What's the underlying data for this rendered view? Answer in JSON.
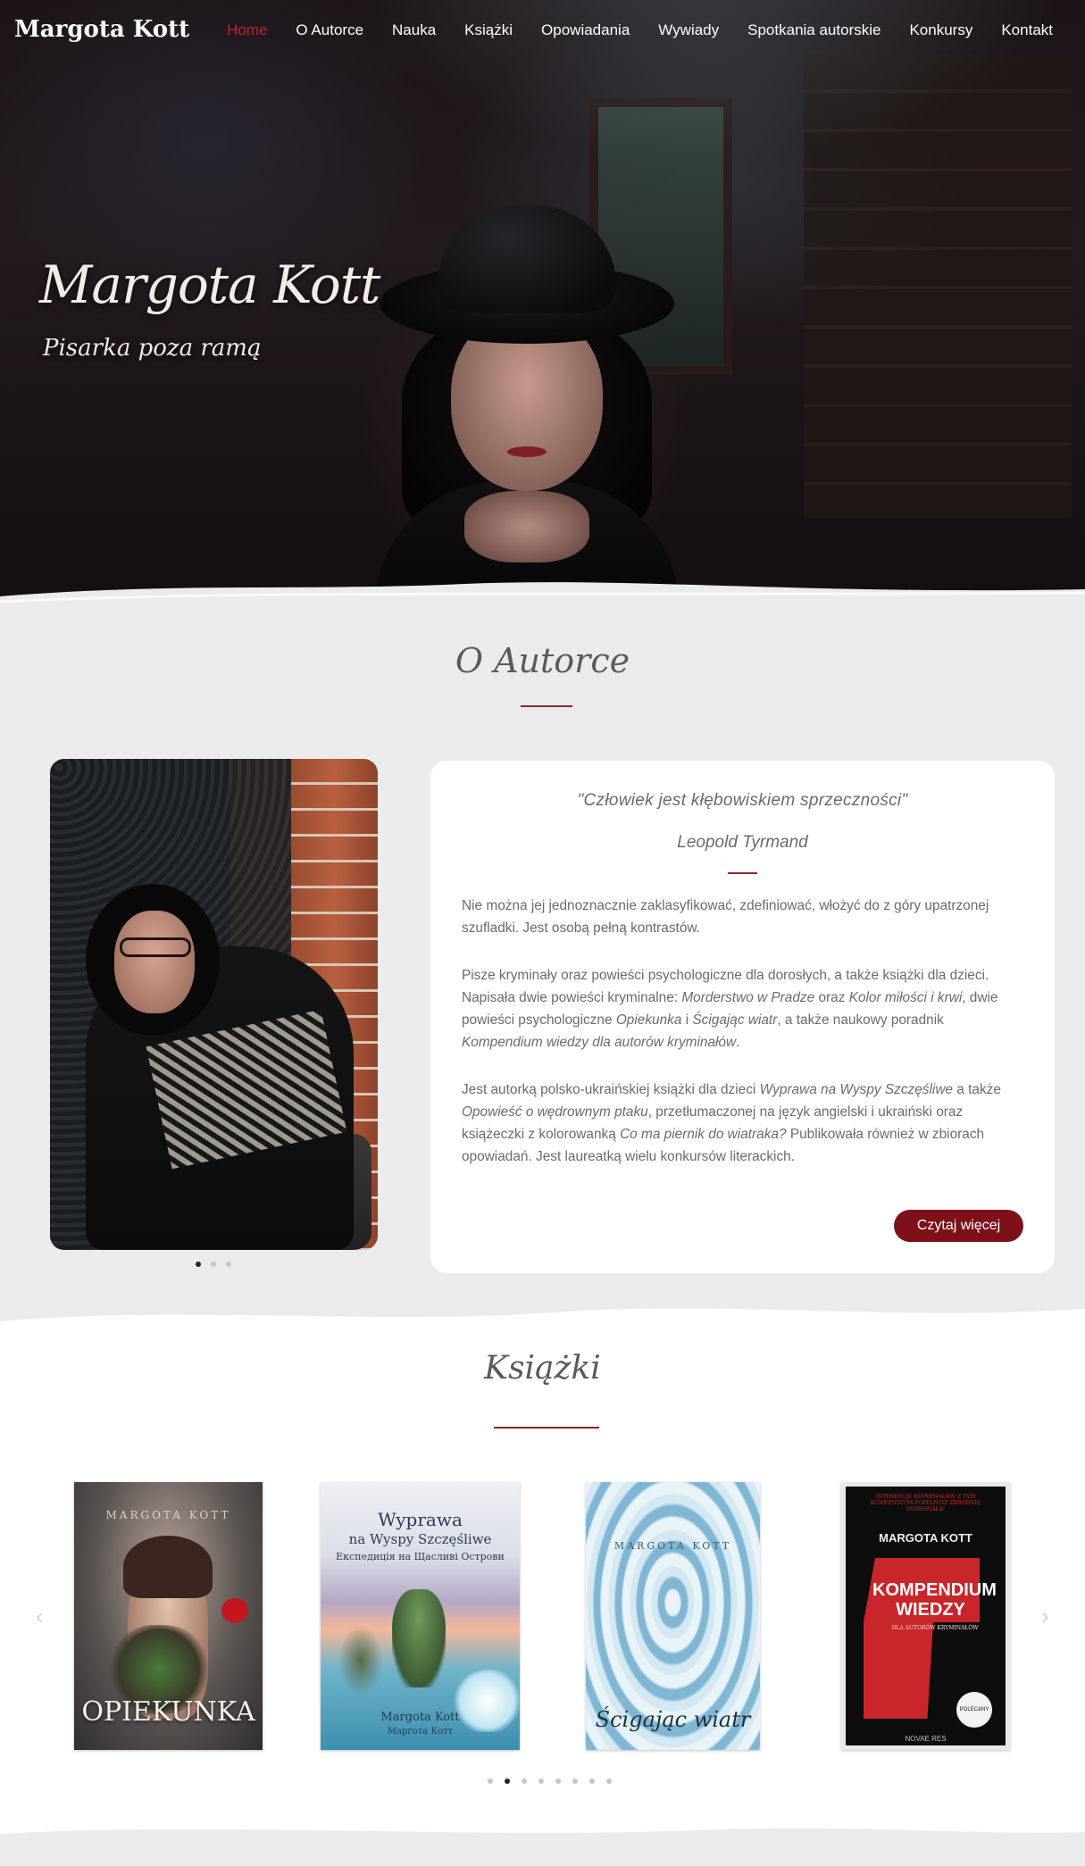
{
  "nav": {
    "brand": "Margota Kott",
    "items": [
      "Home",
      "O Autorce",
      "Nauka",
      "Książki",
      "Opowiadania",
      "Wywiady",
      "Spotkania autorskie",
      "Konkursy",
      "Kontakt"
    ],
    "active": "Home"
  },
  "hero": {
    "title": "Margota Kott",
    "subtitle": "Pisarka poza ramą"
  },
  "about": {
    "heading": "O Autorce",
    "quote": "\"Człowiek jest kłębowiskiem sprzeczności\"",
    "quote_author": "Leopold Tyrmand",
    "p1": "Nie można jej jednoznacznie zaklasyfikować, zdefiniować, włożyć do z góry upatrzonej szufladki. Jest osobą pełną kontrastów.",
    "p2_a": "Pisze kryminały oraz powieści psychologiczne dla dorosłych, a także książki dla dzieci. Napisała dwie powieści kryminalne: ",
    "p2_b": "Morderstwo w Pradze",
    "p2_c": " oraz ",
    "p2_d": "Kolor miłości i krwi",
    "p2_e": ", dwie powieści psychologiczne ",
    "p2_f": "Opiekunka",
    "p2_g": " i ",
    "p2_h": "Ścigając wiatr",
    "p2_i": ", a także naukowy  poradnik ",
    "p2_j": "Kompendium wiedzy dla autorów kryminałów",
    "p2_k": ".",
    "p3_a": "Jest autorką polsko-ukraińskiej książki dla dzieci ",
    "p3_b": "Wyprawa na Wyspy Szczęśliwe",
    "p3_c": " a także ",
    "p3_d": "Opowieść o wędrownym ptaku",
    "p3_e": ", przetłumaczonej na język angielski i ukraiński oraz książeczki z kolorowanką ",
    "p3_f": "Co ma piernik do wiatraka?",
    "p3_g": " Publikowała również w zbiorach opowiadań. Jest laureatką wielu konkursów literackich.",
    "button": "Czytaj więcej",
    "slider_dots": 3,
    "slider_active": 0
  },
  "books": {
    "heading": "Książki",
    "covers": [
      {
        "author": "MARGOTA KOTT",
        "title": "OPIEKUNKA"
      },
      {
        "title": "Wyprawa",
        "title2": "na Wyspy Szczęśliwe",
        "subtitle": "Експедиція на Щасливі Острови",
        "author": "Margota Kott",
        "author2": "Марґота Котт"
      },
      {
        "author": "MARGOTA KOTT",
        "title": "Ścigając wiatr"
      },
      {
        "tagline": "INTERESUJE KRYMINAŁÓW, Z TYM KOMPENDIUM POPEŁNISZ ZBRODNIĘ DOSKONAŁĄ!",
        "author": "MARGOTA KOTT",
        "title": "KOMPENDIUM WIEDZY",
        "subtitle": "DLA AUTORÓW KRYMINAŁÓW",
        "badge": "POLECANY",
        "publisher": "NOVAE RES"
      }
    ],
    "slider_dots": 8,
    "slider_active": 1,
    "prev_icon": "‹",
    "next_icon": "›"
  },
  "colors": {
    "accent": "#7d1019",
    "active_nav": "#c0242e",
    "background": "#ebebee"
  }
}
